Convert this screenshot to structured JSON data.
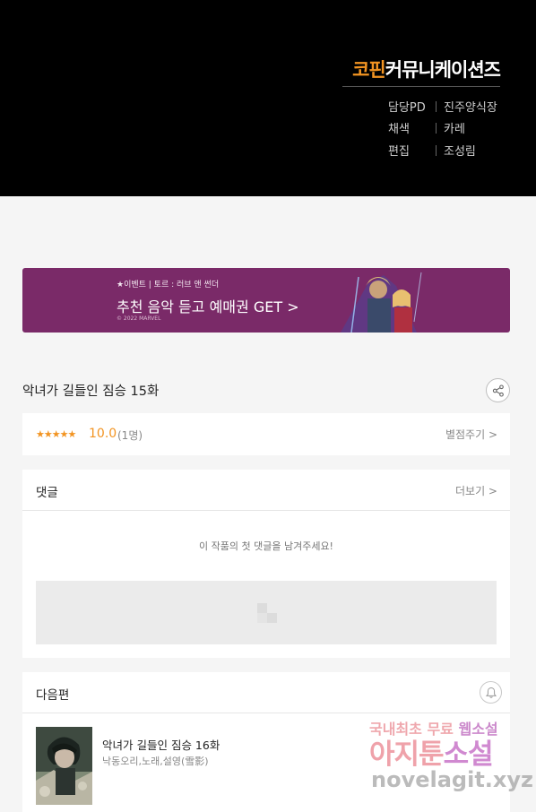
{
  "credits": {
    "brand_part1": "코핀",
    "brand_part2": "커뮤니케이션즈",
    "rows": [
      {
        "role": "담당PD",
        "name": "진주양식장"
      },
      {
        "role": "채색",
        "name": "카레"
      },
      {
        "role": "편집",
        "name": "조성림"
      }
    ]
  },
  "banner": {
    "tag": "★이벤트 | 토르 : 러브 앤 썬더",
    "headline": "추천 음악 듣고 예매권 GET >",
    "copyright": "© 2022 MARVEL"
  },
  "episode": {
    "title": "악녀가 길들인 짐승 15화",
    "share_icon": "share-icon"
  },
  "rating": {
    "stars": "★★★★★",
    "score": "10.0",
    "count": "(1명)",
    "rate_link": "별점주기 >",
    "star_color": "#f29422"
  },
  "comments": {
    "title": "댓글",
    "more_link": "더보기 >",
    "empty_message": "이 작품의 첫 댓글을 남겨주세요!"
  },
  "next": {
    "title": "다음편",
    "bell_icon": "bell-icon",
    "episode_title": "악녀가 길들인 짐승 16화",
    "authors": "낙동오리,노래,설영(雪影)"
  },
  "watermark": {
    "line1_a": "국내최초 무료",
    "line1_b": "웹소설",
    "line2_a": "아지툰",
    "line2_b": "소설",
    "line3": "novelagit.xyz"
  }
}
